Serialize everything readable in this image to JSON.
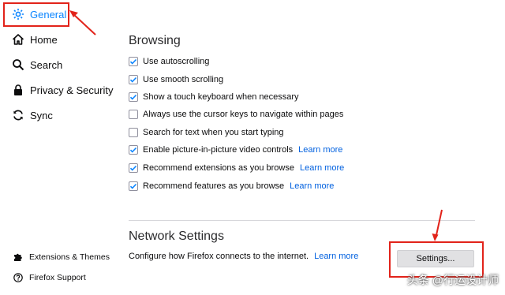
{
  "sidebar": {
    "items": [
      {
        "label": "General",
        "icon": "gear-icon",
        "selected": true
      },
      {
        "label": "Home",
        "icon": "home-icon"
      },
      {
        "label": "Search",
        "icon": "search-icon"
      },
      {
        "label": "Privacy & Security",
        "icon": "lock-icon"
      },
      {
        "label": "Sync",
        "icon": "sync-icon"
      }
    ],
    "footer": [
      {
        "label": "Extensions & Themes",
        "icon": "puzzle-icon"
      },
      {
        "label": "Firefox Support",
        "icon": "help-icon"
      }
    ]
  },
  "browsing": {
    "title": "Browsing",
    "options": [
      {
        "label": "Use autoscrolling",
        "checked": true
      },
      {
        "label": "Use smooth scrolling",
        "checked": true
      },
      {
        "label": "Show a touch keyboard when necessary",
        "checked": true
      },
      {
        "label": "Always use the cursor keys to navigate within pages",
        "checked": false
      },
      {
        "label": "Search for text when you start typing",
        "checked": false
      },
      {
        "label": "Enable picture-in-picture video controls",
        "checked": true,
        "link": "Learn more"
      },
      {
        "label": "Recommend extensions as you browse",
        "checked": true,
        "link": "Learn more"
      },
      {
        "label": "Recommend features as you browse",
        "checked": true,
        "link": "Learn more"
      }
    ]
  },
  "network": {
    "title": "Network Settings",
    "description": "Configure how Firefox connects to the internet.",
    "link": "Learn more",
    "button": "Settings..."
  },
  "watermark": "头条 @行运设计师",
  "colors": {
    "accent": "#0a84ff",
    "link": "#0060df",
    "annotation": "#e2231a",
    "checkbox": "#0a84ff"
  }
}
